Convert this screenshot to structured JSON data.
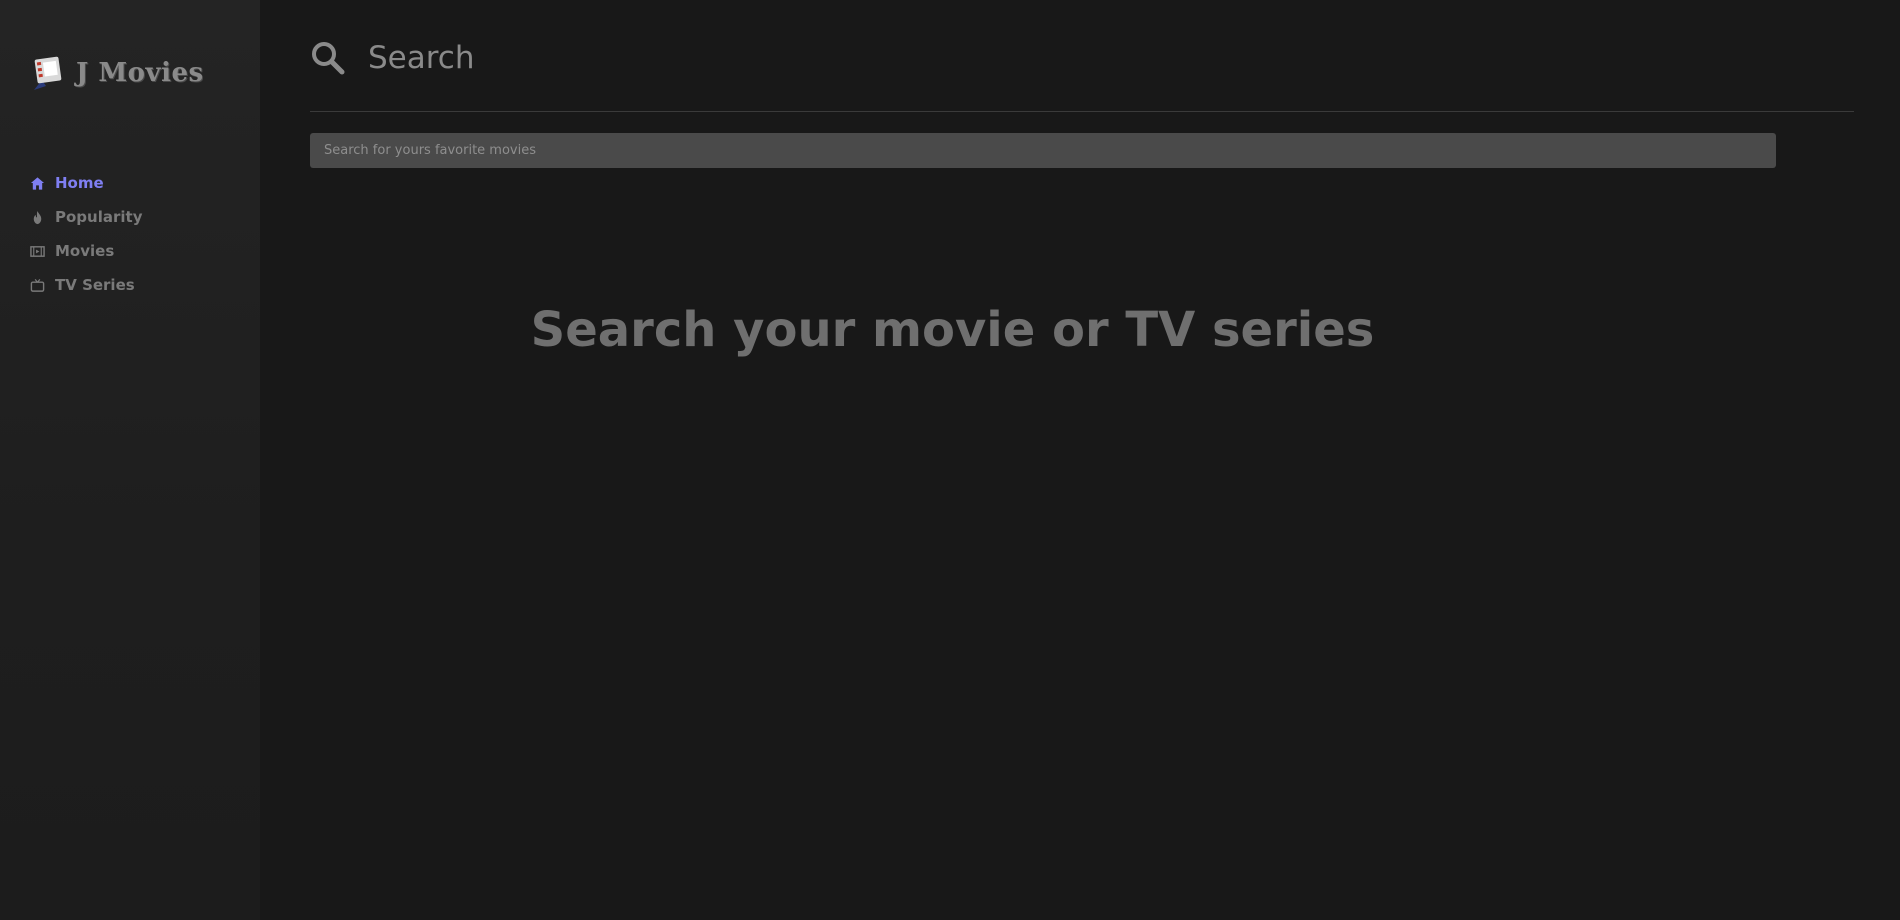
{
  "brand": {
    "name": "J Movies",
    "icon": "film-clapper-icon"
  },
  "sidebar": {
    "items": [
      {
        "label": "Home",
        "icon": "home-icon",
        "active": true
      },
      {
        "label": "Popularity",
        "icon": "flame-icon",
        "active": false
      },
      {
        "label": "Movies",
        "icon": "film-icon",
        "active": false
      },
      {
        "label": "TV Series",
        "icon": "tv-icon",
        "active": false
      }
    ]
  },
  "header": {
    "title": "Search",
    "icon": "search-icon"
  },
  "search": {
    "placeholder": "Search for yours favorite movies",
    "value": ""
  },
  "main": {
    "empty_message": "Search your movie or TV series"
  },
  "colors": {
    "accent": "#7f7ff2",
    "background": "#181818",
    "sidebar": "#222222",
    "input": "#4a4a4a"
  }
}
